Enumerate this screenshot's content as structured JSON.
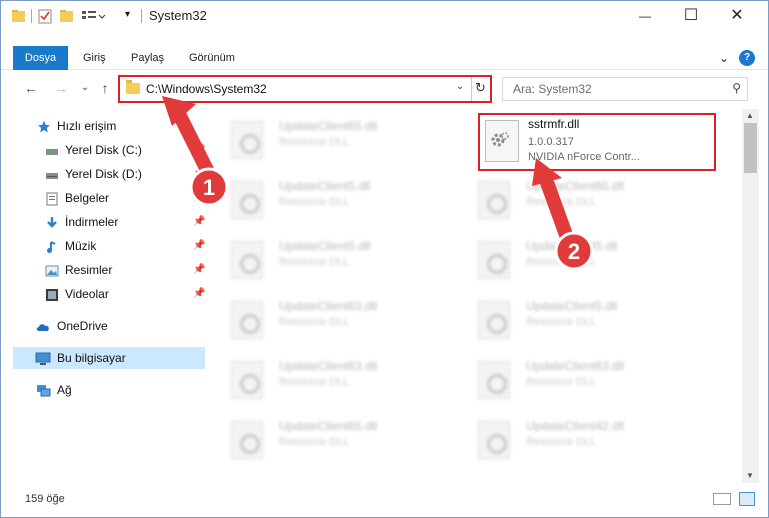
{
  "window": {
    "title": "System32",
    "minimize_glyph": "—",
    "maximize_glyph": "☐",
    "close_glyph": "✕"
  },
  "ribbon": {
    "tabs": [
      "Dosya",
      "Giriş",
      "Paylaş",
      "Görünüm"
    ],
    "expand_glyph": "⌄",
    "help_glyph": "?"
  },
  "nav": {
    "back_glyph": "←",
    "forward_glyph": "→",
    "recent_glyph": "⌄",
    "up_glyph": "↑",
    "address_path": "C:\\Windows\\System32",
    "address_dropdown_glyph": "⌄",
    "refresh_glyph": "↻",
    "search_placeholder": "Ara: System32",
    "search_glyph": "⚲"
  },
  "sidebar": {
    "items": [
      {
        "label": "Hızlı erişim",
        "icon": "star-icon"
      },
      {
        "label": "Yerel Disk (C:)",
        "icon": "drive-icon",
        "pinned": true
      },
      {
        "label": "Yerel Disk (D:)",
        "icon": "drive-icon",
        "pinned": true
      },
      {
        "label": "Belgeler",
        "icon": "documents-icon",
        "pinned": true
      },
      {
        "label": "İndirmeler",
        "icon": "download-icon",
        "pinned": true
      },
      {
        "label": "Müzik",
        "icon": "music-icon",
        "pinned": true
      },
      {
        "label": "Resimler",
        "icon": "pictures-icon",
        "pinned": true
      },
      {
        "label": "Videolar",
        "icon": "videos-icon",
        "pinned": true
      },
      {
        "label": "OneDrive",
        "icon": "cloud-icon"
      },
      {
        "label": "Bu bilgisayar",
        "icon": "computer-icon",
        "selected": true
      },
      {
        "label": "Ağ",
        "icon": "network-icon"
      }
    ],
    "pin_glyph": "📌"
  },
  "files": {
    "left": [
      {
        "name": "UpdateClient65.dll",
        "desc": "Resource DLL"
      },
      {
        "name": "UpdateClient5.dll",
        "desc": "Resource DLL"
      },
      {
        "name": "UpdateClient5.dll",
        "desc": "Resource DLL"
      },
      {
        "name": "UpdateClient63.dll",
        "desc": "Resource DLL"
      },
      {
        "name": "UpdateClient63.dll",
        "desc": "Resource DLL"
      },
      {
        "name": "UpdateClient65.dll",
        "desc": "Resource DLL"
      }
    ],
    "right": [
      {
        "name": "UpdateClient65.dll",
        "desc": "Resource DLL"
      },
      {
        "name": "UpdateClient5.dll",
        "desc": "Resource DLL"
      },
      {
        "name": "UpdateClient5.dll",
        "desc": "Resource DLL"
      },
      {
        "name": "UpdateClient63.dll",
        "desc": "Resource DLL"
      },
      {
        "name": "UpdateClient42.dll",
        "desc": "Resource DLL"
      }
    ],
    "highlighted": {
      "name": "sstrmfr.dll",
      "version": "1.0.0.317",
      "desc": "NVIDIA nForce Contr..."
    }
  },
  "status": {
    "count": "159 öğe"
  },
  "annotations": {
    "badge1": "1",
    "badge2": "2",
    "arrow_color": "#e03a3a"
  },
  "colors": {
    "accent": "#1979ca",
    "highlight_border": "#e02020",
    "selection": "#cce8ff"
  }
}
